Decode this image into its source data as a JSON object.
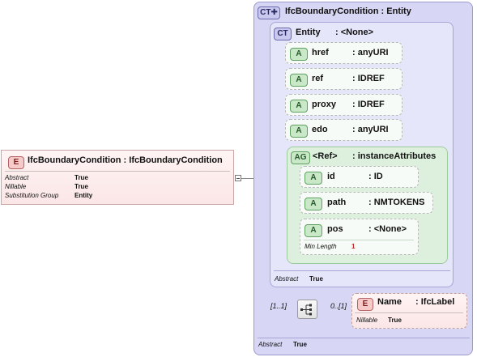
{
  "root_element": {
    "badge": "E",
    "title": "IfcBoundaryCondition : IfcBoundaryCondition",
    "properties": [
      {
        "key": "Abstract",
        "value": "True"
      },
      {
        "key": "Nillable",
        "value": "True"
      },
      {
        "key": "Substitution Group",
        "value": "Entity"
      }
    ]
  },
  "complex_type": {
    "badge": "CT",
    "title": "IfcBoundaryCondition : Entity",
    "abstract_key": "Abstract",
    "abstract_value": "True"
  },
  "entity_type": {
    "badge": "CT",
    "name": "Entity",
    "type": ": <None>",
    "abstract_key": "Abstract",
    "abstract_value": "True"
  },
  "attributes": [
    {
      "badge": "A",
      "name": "href",
      "type": ": anyURI"
    },
    {
      "badge": "A",
      "name": "ref",
      "type": ": IDREF"
    },
    {
      "badge": "A",
      "name": "proxy",
      "type": ": IDREF"
    },
    {
      "badge": "A",
      "name": "edo",
      "type": ": anyURI"
    }
  ],
  "attribute_group": {
    "badge": "AG",
    "name": "<Ref>",
    "type": ": instanceAttributes",
    "attributes": [
      {
        "badge": "A",
        "name": "id",
        "type": ": ID"
      },
      {
        "badge": "A",
        "name": "path",
        "type": ": NMTOKENS"
      },
      {
        "badge": "A",
        "name": "pos",
        "type": ": <None>",
        "facet_key": "Min Length",
        "facet_value": "1"
      }
    ]
  },
  "sequence": {
    "cardinality": "[1..1]",
    "child_cardinality": "0..[1]"
  },
  "name_element": {
    "badge": "E",
    "name": "Name",
    "type": ": IfcLabel",
    "nillable_key": "Nillable",
    "nillable_value": "True"
  }
}
